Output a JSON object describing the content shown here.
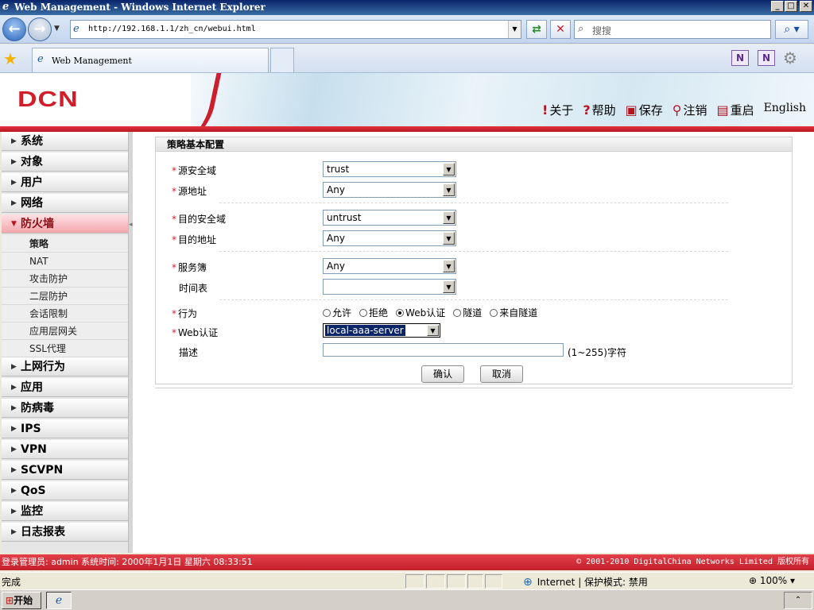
{
  "window": {
    "title": "Web Management - Windows Internet Explorer",
    "btn_min": "_",
    "btn_max": "□",
    "btn_close": "✕"
  },
  "browser": {
    "url": "http://192.168.1.1/zh_cn/webui.html",
    "search_placeholder": "搜搜",
    "tab_title": "Web Management"
  },
  "header": {
    "logo": "DCN",
    "links": [
      {
        "icon": "info-icon",
        "glyph": "!",
        "label": "关于"
      },
      {
        "icon": "help-icon",
        "glyph": "?",
        "label": "帮助"
      },
      {
        "icon": "save-icon",
        "glyph": "▣",
        "label": "保存"
      },
      {
        "icon": "logout-icon",
        "glyph": "⚲",
        "label": "注销"
      },
      {
        "icon": "reboot-icon",
        "glyph": "▤",
        "label": "重启"
      }
    ],
    "language": "English"
  },
  "sidebar": {
    "items_top": [
      "系统",
      "对象",
      "用户",
      "网络"
    ],
    "active": "防火墙",
    "sub_items": [
      "策略",
      "NAT",
      "攻击防护",
      "二层防护",
      "会话限制",
      "应用层网关",
      "SSL代理"
    ],
    "items_bottom": [
      "上网行为",
      "应用",
      "防病毒",
      "IPS",
      "VPN",
      "SCVPN",
      "QoS",
      "监控",
      "日志报表"
    ]
  },
  "form": {
    "title": "策略基本配置",
    "src_zone_label": "源安全域",
    "src_zone_value": "trust",
    "src_addr_label": "源地址",
    "src_addr_value": "Any",
    "dst_zone_label": "目的安全域",
    "dst_zone_value": "untrust",
    "dst_addr_label": "目的地址",
    "dst_addr_value": "Any",
    "service_label": "服务簿",
    "service_value": "Any",
    "schedule_label": "时间表",
    "schedule_value": "",
    "action_label": "行为",
    "actions": [
      "允许",
      "拒绝",
      "Web认证",
      "隧道",
      "来自隧道"
    ],
    "action_selected": "Web认证",
    "webauth_label": "Web认证",
    "webauth_value": "local-aaa-server",
    "desc_label": "描述",
    "desc_value": "",
    "desc_hint": "(1~255)字符",
    "confirm": "确认",
    "cancel": "取消",
    "required_mark": "*"
  },
  "footer": {
    "left": "登录管理员: admin 系统时间: 2000年1月1日 星期六 08:33:51",
    "right": "© 2001-2010 DigitalChina Networks Limited 版权所有"
  },
  "statusbar": {
    "status": "完成",
    "zone": "Internet | 保护模式: 禁用",
    "zoom": "100%"
  },
  "taskbar": {
    "start": "开始"
  }
}
